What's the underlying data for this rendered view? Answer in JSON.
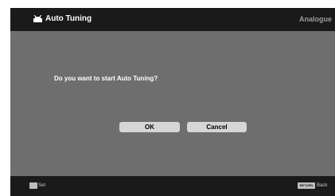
{
  "header": {
    "title": "Auto Tuning",
    "mode": "Analogue",
    "icon": "tv-antenna-icon"
  },
  "dialog": {
    "prompt": "Do you want to start Auto Tuning?",
    "ok_label": "OK",
    "cancel_label": "Cancel"
  },
  "footer": {
    "set_key": "",
    "set_label": "Set",
    "return_key": "RETURN",
    "back_label": "Back"
  },
  "colors": {
    "background": "#6e6e6e",
    "bar": "#1a1a1a",
    "button": "#d6d6d6",
    "text": "#ffffff"
  }
}
